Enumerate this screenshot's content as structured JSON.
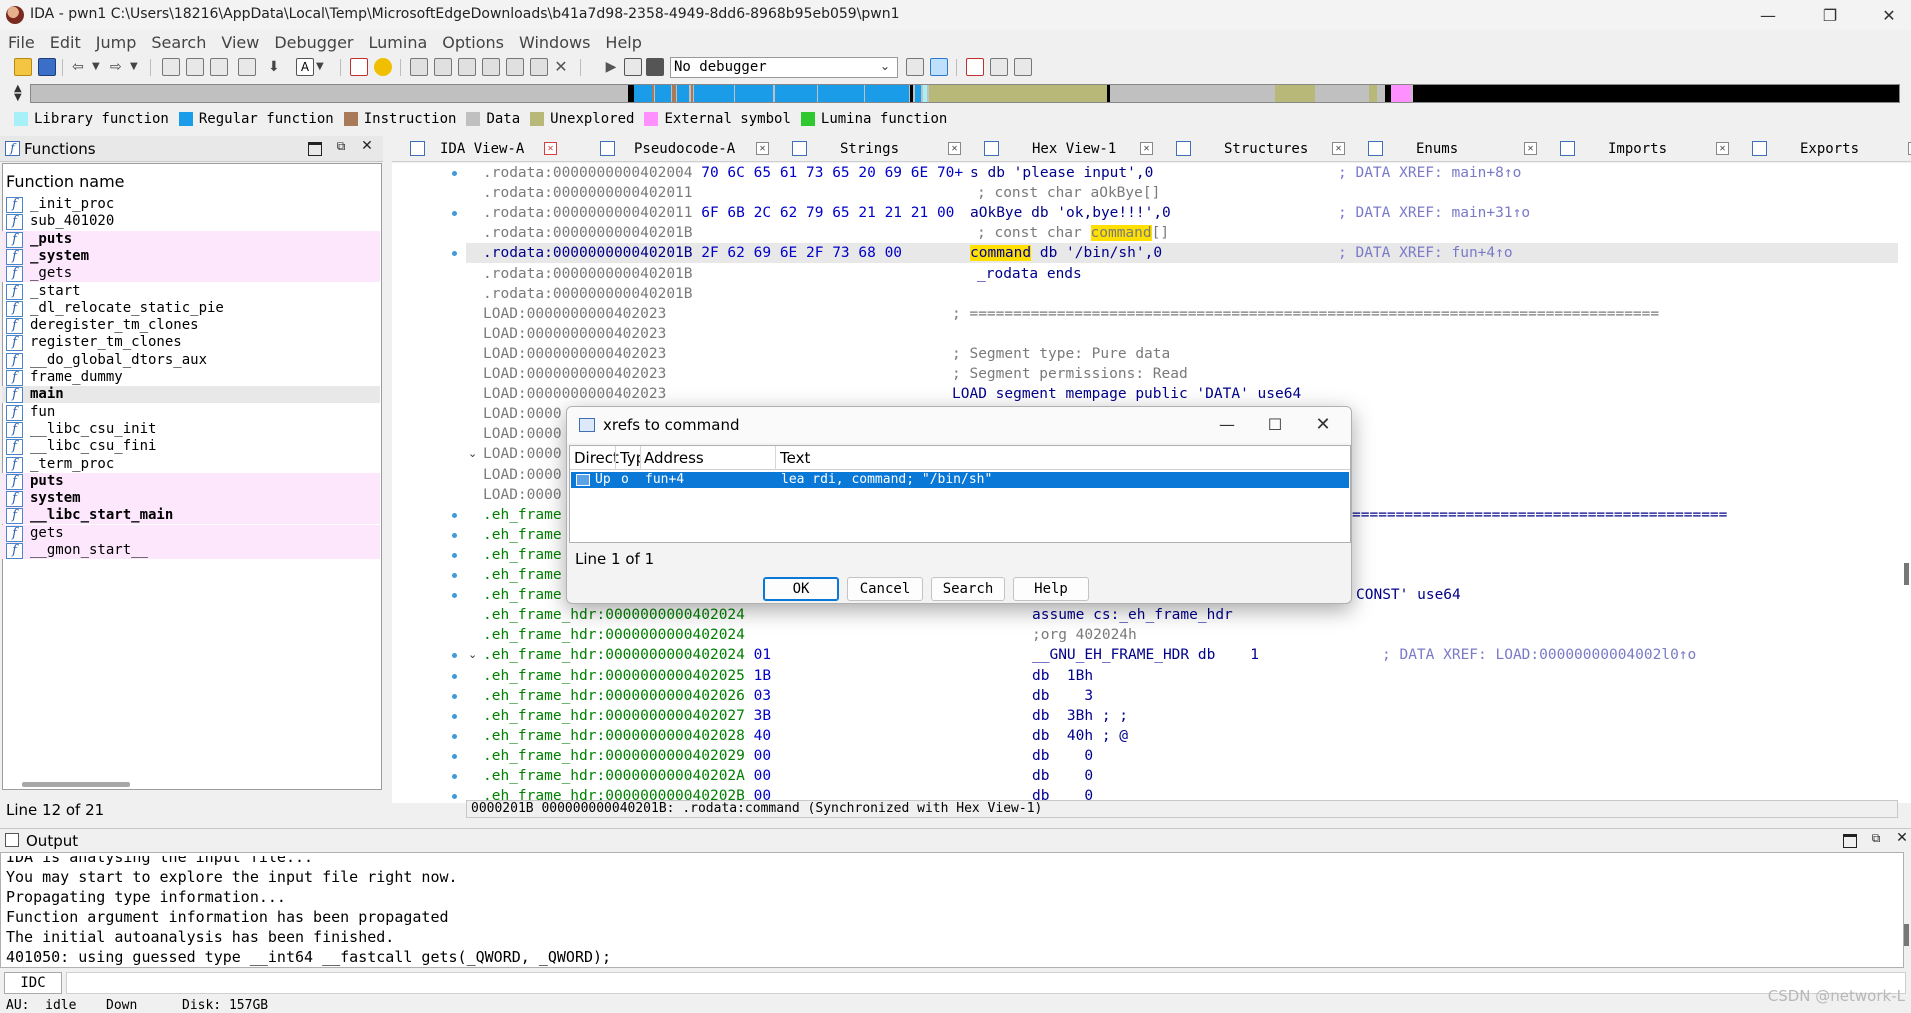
{
  "window": {
    "title": "IDA - pwn1 C:\\Users\\18216\\AppData\\Local\\Temp\\MicrosoftEdgeDownloads\\b41a7d98-2358-4949-8dd6-8968b95eb059\\pwn1",
    "minimize": "—",
    "maximize": "❐",
    "close": "✕"
  },
  "menu": [
    "File",
    "Edit",
    "Jump",
    "Search",
    "View",
    "Debugger",
    "Lumina",
    "Options",
    "Windows",
    "Help"
  ],
  "toolbar": {
    "debugger": "No debugger"
  },
  "legend": [
    {
      "label": "Library function",
      "color": "#a8f0f8"
    },
    {
      "label": "Regular function",
      "color": "#1a9ce8"
    },
    {
      "label": "Instruction",
      "color": "#a87a58"
    },
    {
      "label": "Data",
      "color": "#c0c0c0"
    },
    {
      "label": "Unexplored",
      "color": "#b8b878"
    },
    {
      "label": "External symbol",
      "color": "#ff90ff"
    },
    {
      "label": "Lumina function",
      "color": "#30c830"
    }
  ],
  "functions_panel": {
    "title": "Functions",
    "column": "Function name",
    "status": "Line 12 of 21",
    "items": [
      {
        "name": "_init_proc",
        "kind": "regular",
        "bold": false
      },
      {
        "name": "sub_401020",
        "kind": "regular",
        "bold": false
      },
      {
        "name": "_puts",
        "kind": "lib",
        "bold": true
      },
      {
        "name": "_system",
        "kind": "lib",
        "bold": true
      },
      {
        "name": "_gets",
        "kind": "lib",
        "bold": false
      },
      {
        "name": "_start",
        "kind": "regular",
        "bold": false
      },
      {
        "name": "_dl_relocate_static_pie",
        "kind": "regular",
        "bold": false
      },
      {
        "name": "deregister_tm_clones",
        "kind": "regular",
        "bold": false
      },
      {
        "name": "register_tm_clones",
        "kind": "regular",
        "bold": false
      },
      {
        "name": "__do_global_dtors_aux",
        "kind": "regular",
        "bold": false
      },
      {
        "name": "frame_dummy",
        "kind": "regular",
        "bold": false
      },
      {
        "name": "main",
        "kind": "selected",
        "bold": true
      },
      {
        "name": "fun",
        "kind": "regular",
        "bold": false
      },
      {
        "name": "__libc_csu_init",
        "kind": "regular",
        "bold": false
      },
      {
        "name": "__libc_csu_fini",
        "kind": "regular",
        "bold": false
      },
      {
        "name": "_term_proc",
        "kind": "regular",
        "bold": false
      },
      {
        "name": "puts",
        "kind": "lib",
        "bold": true
      },
      {
        "name": "system",
        "kind": "lib",
        "bold": true
      },
      {
        "name": "__libc_start_main",
        "kind": "lib",
        "bold": true
      },
      {
        "name": "gets",
        "kind": "lib",
        "bold": false
      },
      {
        "name": "__gmon_start__",
        "kind": "lib",
        "bold": false
      }
    ]
  },
  "tabs": [
    {
      "label": "IDA View-A",
      "active": true
    },
    {
      "label": "Pseudocode-A",
      "active": false
    },
    {
      "label": "Strings",
      "active": false
    },
    {
      "label": "Hex View-1",
      "active": false
    },
    {
      "label": "Structures",
      "active": false
    },
    {
      "label": "Enums",
      "active": false
    },
    {
      "label": "Imports",
      "active": false
    },
    {
      "label": "Exports",
      "active": false
    }
  ],
  "code_lines": [
    {
      "addr": ".rodata:0000000000402004",
      "bytes": " 70 6C 65 61 73 65 20 69 6E 70+",
      "body": "s db 'please input',0",
      "comment": "; DATA XREF: main+8↑o",
      "kind": "rodata",
      "bullet": true
    },
    {
      "addr": ".rodata:0000000000402011",
      "bytes": "",
      "body": "; const char aOkBye[]",
      "comment": "",
      "kind": "rodata",
      "bullet": false,
      "body_col": 2
    },
    {
      "addr": ".rodata:0000000000402011",
      "bytes": " 6F 6B 2C 62 79 65 21 21 21 00",
      "body": "aOkBye db 'ok,bye!!!',0",
      "comment": "; DATA XREF: main+31↑o",
      "kind": "rodata",
      "bullet": true
    },
    {
      "addr": ".rodata:000000000040201B",
      "bytes": "",
      "body": "; const char command[]",
      "comment": "",
      "kind": "rodata",
      "bullet": false,
      "body_col": 2
    },
    {
      "addr": ".rodata:000000000040201B",
      "bytes": " 2F 62 69 6E 2F 73 68 00",
      "body": "command db '/bin/sh',0",
      "comment": "; DATA XREF: fun+4↑o",
      "kind": "rodata",
      "bullet": true,
      "highlight": true
    },
    {
      "addr": ".rodata:000000000040201B",
      "bytes": "",
      "body": "_rodata ends",
      "comment": "",
      "kind": "rodata",
      "bullet": false,
      "body_col": 2
    },
    {
      "addr": ".rodata:000000000040201B",
      "bytes": "",
      "body": "",
      "comment": "",
      "kind": "rodata",
      "bullet": false
    },
    {
      "addr": "LOAD:0000000000402023",
      "bytes": "",
      "body": "; ===============================================================================",
      "comment": "",
      "kind": "load",
      "bullet": false,
      "body_col": 1
    },
    {
      "addr": "LOAD:0000000000402023",
      "bytes": "",
      "body": "",
      "comment": "",
      "kind": "load",
      "bullet": false
    },
    {
      "addr": "LOAD:0000000000402023",
      "bytes": "",
      "body": "; Segment type: Pure data",
      "comment": "",
      "kind": "load",
      "bullet": false,
      "body_col": 1
    },
    {
      "addr": "LOAD:0000000000402023",
      "bytes": "",
      "body": "; Segment permissions: Read",
      "comment": "",
      "kind": "load",
      "bullet": false,
      "body_col": 1
    },
    {
      "addr": "LOAD:0000000000402023",
      "bytes": "",
      "body": "LOAD segment mempage public 'DATA' use64",
      "comment": "",
      "kind": "load",
      "bullet": false,
      "body_col": 1
    },
    {
      "addr": "LOAD:0000",
      "bytes": "",
      "body": "",
      "comment": "",
      "kind": "load",
      "bullet": false
    },
    {
      "addr": "LOAD:0000",
      "bytes": "",
      "body": "",
      "comment": "",
      "kind": "load",
      "bullet": false
    },
    {
      "addr": "LOAD:0000",
      "bytes": "",
      "body": "",
      "comment": "",
      "kind": "load",
      "bullet": false,
      "fold": true
    },
    {
      "addr": "LOAD:0000",
      "bytes": "",
      "body": "",
      "comment": "",
      "kind": "load",
      "bullet": false
    },
    {
      "addr": "LOAD:0000",
      "bytes": "",
      "body": "",
      "comment": "",
      "kind": "load",
      "bullet": false
    },
    {
      "addr": ".eh_frame",
      "bytes": "",
      "body": "",
      "comment": "",
      "kind": "eh",
      "bullet": true,
      "tail": "==========================================="
    },
    {
      "addr": ".eh_frame",
      "bytes": "",
      "body": "",
      "comment": "",
      "kind": "eh",
      "bullet": true
    },
    {
      "addr": ".eh_frame",
      "bytes": "",
      "body": "",
      "comment": "",
      "kind": "eh",
      "bullet": true
    },
    {
      "addr": ".eh_frame",
      "bytes": "",
      "body": "",
      "comment": "",
      "kind": "eh",
      "bullet": true
    },
    {
      "addr": ".eh_frame",
      "bytes": "",
      "body": "",
      "comment": "",
      "kind": "eh",
      "bullet": true,
      "tail": "CONST' use64"
    },
    {
      "addr": ".eh_frame_hdr:0000000000402024",
      "bytes": "",
      "body": "assume cs:_eh_frame_hdr",
      "comment": "",
      "kind": "eh",
      "bullet": false,
      "body_col": 3
    },
    {
      "addr": ".eh_frame_hdr:0000000000402024",
      "bytes": "",
      "body": ";org 402024h",
      "comment": "",
      "kind": "eh",
      "bullet": false,
      "body_col": 3
    },
    {
      "addr": ".eh_frame_hdr:0000000000402024",
      "bytes": " 01",
      "body": "__GNU_EH_FRAME_HDR db    1",
      "comment": "; DATA XREF: LOAD:00000000004002l0↑o",
      "kind": "eh",
      "bullet": true,
      "fold": true,
      "body_col": 3
    },
    {
      "addr": ".eh_frame_hdr:0000000000402025",
      "bytes": " 1B",
      "body": "db  1Bh",
      "comment": "",
      "kind": "eh",
      "bullet": true,
      "body_col": 3
    },
    {
      "addr": ".eh_frame_hdr:0000000000402026",
      "bytes": " 03",
      "body": "db    3",
      "comment": "",
      "kind": "eh",
      "bullet": true,
      "body_col": 3
    },
    {
      "addr": ".eh_frame_hdr:0000000000402027",
      "bytes": " 3B",
      "body": "db  3Bh ; ;",
      "comment": "",
      "kind": "eh",
      "bullet": true,
      "body_col": 3
    },
    {
      "addr": ".eh_frame_hdr:0000000000402028",
      "bytes": " 40",
      "body": "db  40h ; @",
      "comment": "",
      "kind": "eh",
      "bullet": true,
      "body_col": 3
    },
    {
      "addr": ".eh_frame_hdr:0000000000402029",
      "bytes": " 00",
      "body": "db    0",
      "comment": "",
      "kind": "eh",
      "bullet": true,
      "body_col": 3
    },
    {
      "addr": ".eh_frame_hdr:000000000040202A",
      "bytes": " 00",
      "body": "db    0",
      "comment": "",
      "kind": "eh",
      "bullet": true,
      "body_col": 3
    },
    {
      "addr": ".eh_frame_hdr:000000000040202B",
      "bytes": " 00",
      "body": "db    0",
      "comment": "",
      "kind": "eh",
      "bullet": true,
      "body_col": 3
    }
  ],
  "code_status": "0000201B 000000000040201B: .rodata:command (Synchronized with Hex View-1)",
  "dialog": {
    "title": "xrefs to command",
    "columns": [
      "Direct",
      "Typ",
      "Address",
      "Text"
    ],
    "row": {
      "direction": "Up",
      "type": "o",
      "address": "fun+4",
      "text": "lea     rdi, command; \"/bin/sh\""
    },
    "status": "Line 1 of 1",
    "buttons": {
      "ok": "OK",
      "cancel": "Cancel",
      "search": "Search",
      "help": "Help"
    }
  },
  "output": {
    "title": "Output",
    "lines": [
      "IDA is analysing the input file...",
      "You may start to explore the input file right now.",
      "Propagating type information...",
      "Function argument information has been propagated",
      "The initial autoanalysis has been finished.",
      "401050: using guessed type __int64 __fastcall gets(_QWORD, _QWORD);"
    ],
    "idc_label": "IDC"
  },
  "statusbar": {
    "au": "AU:  idle",
    "dir": "Down",
    "disk": "Disk: 157GB"
  },
  "watermark": "CSDN @network-L"
}
